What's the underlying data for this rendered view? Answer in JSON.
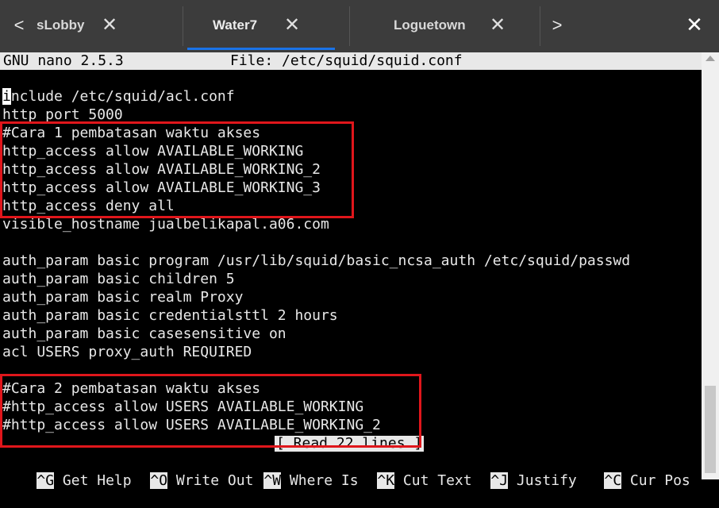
{
  "tabs": [
    {
      "label": "sLobby",
      "active": false
    },
    {
      "label": "Water7",
      "active": true
    },
    {
      "label": "Loguetown",
      "active": false
    }
  ],
  "tab_nav": {
    "prev": "<",
    "next": ">"
  },
  "close_glyph": "✕",
  "window_close": "✕",
  "nano": {
    "title": "GNU nano 2.5.3",
    "file": "File: /etc/squid/squid.conf",
    "first_char": "i",
    "first_rest": "nclude /etc/squid/acl.conf",
    "lines": [
      "http_port 5000",
      "#Cara 1 pembatasan waktu akses",
      "http_access allow AVAILABLE_WORKING",
      "http_access allow AVAILABLE_WORKING_2",
      "http_access allow AVAILABLE_WORKING_3",
      "http_access deny all",
      "visible_hostname jualbelikapal.a06.com",
      "",
      "auth_param basic program /usr/lib/squid/basic_ncsa_auth /etc/squid/passwd",
      "auth_param basic children 5",
      "auth_param basic realm Proxy",
      "auth_param basic credentialsttl 2 hours",
      "auth_param basic casesensitive on",
      "acl USERS proxy_auth REQUIRED",
      "",
      "#Cara 2 pembatasan waktu akses",
      "#http_access allow USERS AVAILABLE_WORKING",
      "#http_access allow USERS AVAILABLE_WORKING_2"
    ],
    "status": "[ Read 22 lines ]",
    "shortcuts": [
      {
        "key": "^G",
        "label": "Get Help"
      },
      {
        "key": "^O",
        "label": "Write Out"
      },
      {
        "key": "^W",
        "label": "Where Is"
      },
      {
        "key": "^K",
        "label": "Cut Text"
      },
      {
        "key": "^J",
        "label": "Justify"
      },
      {
        "key": "^C",
        "label": "Cur Pos"
      }
    ]
  },
  "colors": {
    "highlight": "#e0161b",
    "accent": "#1a73e8",
    "terminal_bg": "#000000"
  }
}
